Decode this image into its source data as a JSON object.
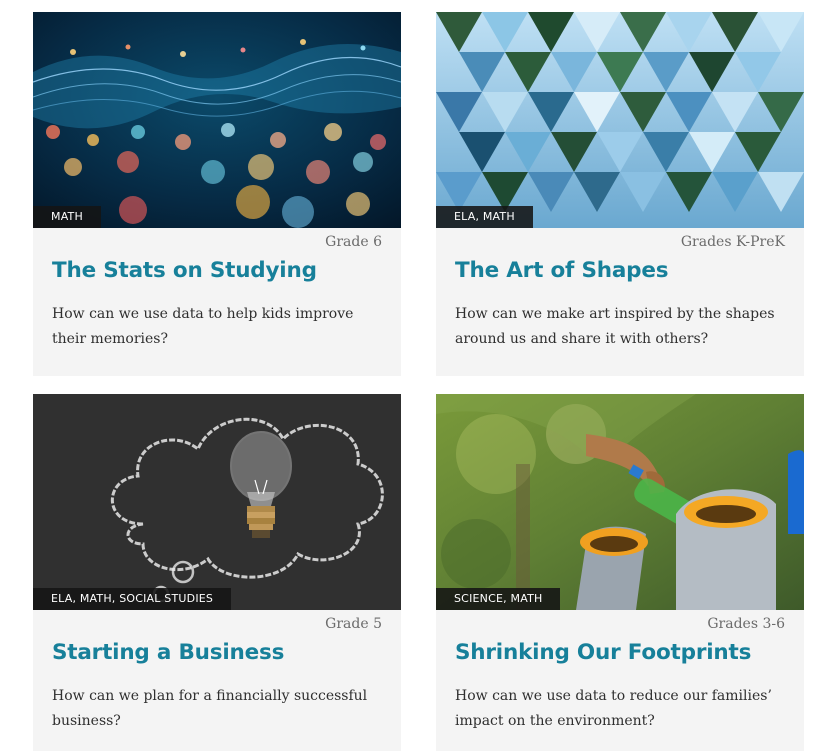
{
  "cards": [
    {
      "tags": "MATH",
      "grade": "Grade 6",
      "title": "The Stats on Studying",
      "description": "How can we use data to help kids improve their memories?",
      "image": "bokeh-data-wave-photo"
    },
    {
      "tags": "ELA, MATH",
      "grade": "Grades K-PreK",
      "title": "The Art of Shapes",
      "description": "How can we make art inspired by the shapes around us and share it with others?",
      "image": "triangle-landscape-mosaic-photo"
    },
    {
      "tags": "ELA, MATH, SOCIAL STUDIES",
      "grade": "Grade 5",
      "title": "Starting a Business",
      "description": "How can we plan for a financially successful business?",
      "image": "lightbulb-chalk-cloud-photo"
    },
    {
      "tags": "SCIENCE, MATH",
      "grade": "Grades 3-6",
      "title": "Shrinking Our Footprints",
      "description": "How can we use data to reduce our families’ impact on the environment?",
      "image": "recycling-bottle-photo"
    }
  ],
  "colors": {
    "title": "#17809a",
    "card_background": "#f4f4f4",
    "tag_background": "#141414"
  }
}
